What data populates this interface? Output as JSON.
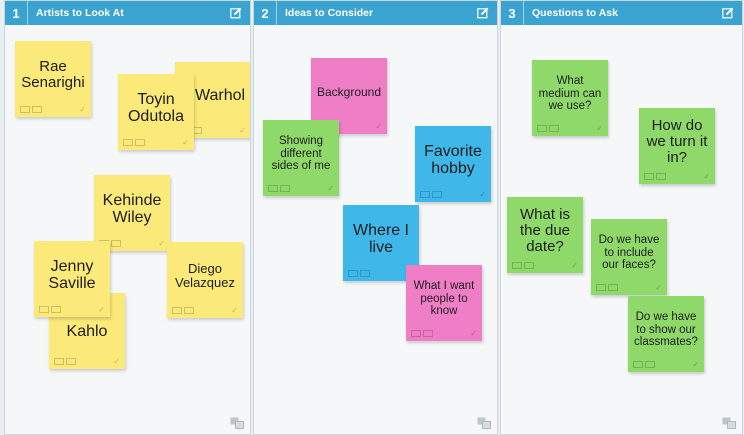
{
  "columns": [
    {
      "number": "1",
      "title": "Artists to Look At",
      "notes": [
        {
          "text": "Rae Senarighi",
          "color": "yellow"
        },
        {
          "text": "Warhol",
          "color": "yellow"
        },
        {
          "text": "Toyin Odutola",
          "color": "yellow"
        },
        {
          "text": "Kehinde Wiley",
          "color": "yellow"
        },
        {
          "text": "Kahlo",
          "color": "yellow"
        },
        {
          "text": "Jenny Saville",
          "color": "yellow"
        },
        {
          "text": "Diego Velazquez",
          "color": "yellow"
        }
      ]
    },
    {
      "number": "2",
      "title": "Ideas to Consider",
      "notes": [
        {
          "text": "Background",
          "color": "pink"
        },
        {
          "text": "Showing different sides of me",
          "color": "green"
        },
        {
          "text": "Favorite hobby",
          "color": "blue"
        },
        {
          "text": "Where I live",
          "color": "blue"
        },
        {
          "text": "What I want people to know",
          "color": "pink"
        }
      ]
    },
    {
      "number": "3",
      "title": "Questions to Ask",
      "notes": [
        {
          "text": "What medium can we use?",
          "color": "green"
        },
        {
          "text": "How do we turn it in?",
          "color": "green"
        },
        {
          "text": "What is the due date?",
          "color": "green"
        },
        {
          "text": "Do we have to include our faces?",
          "color": "green"
        },
        {
          "text": "Do we have to show our classmates?",
          "color": "green"
        }
      ]
    }
  ],
  "icons": {
    "edit": "pencil-square-icon",
    "resize": "resize-icon"
  },
  "colors": {
    "header": "#3aa3cf",
    "yellow": "#fbe97a",
    "pink": "#ef7ec7",
    "green": "#8fd96a",
    "blue": "#3fb7e8"
  }
}
